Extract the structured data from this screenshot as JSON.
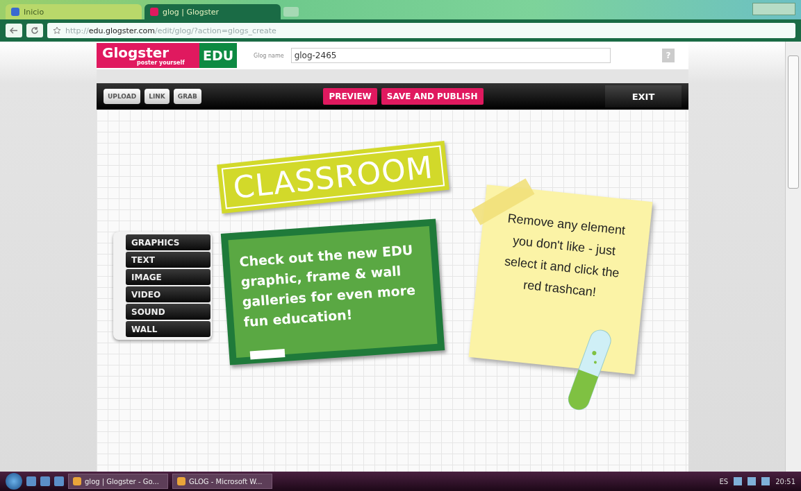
{
  "browser": {
    "tabs": [
      {
        "label": "Inicio",
        "selected": false
      },
      {
        "label": "glog | Glogster",
        "selected": true
      }
    ],
    "url": {
      "scheme": "http://",
      "host": "edu.glogster.com",
      "path": "/edit/glog/?action=glogs_create"
    }
  },
  "header": {
    "logo": {
      "name": "Glogster",
      "tagline": "poster yourself",
      "badge": "EDU"
    },
    "glog_name": {
      "label": "Glog name",
      "value": "glog-2465"
    },
    "help": "?"
  },
  "toolbar": {
    "actions": [
      {
        "kind": "media",
        "label": "UPLOAD"
      },
      {
        "kind": "media",
        "label": "LINK"
      },
      {
        "kind": "media",
        "label": "GRAB"
      },
      {
        "kind": "primary",
        "label": "PREVIEW"
      },
      {
        "kind": "primary",
        "label": "SAVE AND PUBLISH"
      },
      {
        "kind": "exit",
        "label": "EXIT"
      }
    ]
  },
  "tools": {
    "items": [
      "GRAPHICS",
      "TEXT",
      "IMAGE",
      "VIDEO",
      "SOUND",
      "WALL"
    ]
  },
  "canvas": {
    "sign": "CLASSROOM",
    "chalkboard": "Check out the new EDU graphic, frame & wall galleries for even more fun education!",
    "note": "Remove any element you don't like - just select it and click the red trashcan!"
  },
  "taskbar": {
    "tasks": [
      "glog | Glogster - Go...",
      "GLOG - Microsoft W..."
    ],
    "language": "ES",
    "clock": "20:51"
  }
}
